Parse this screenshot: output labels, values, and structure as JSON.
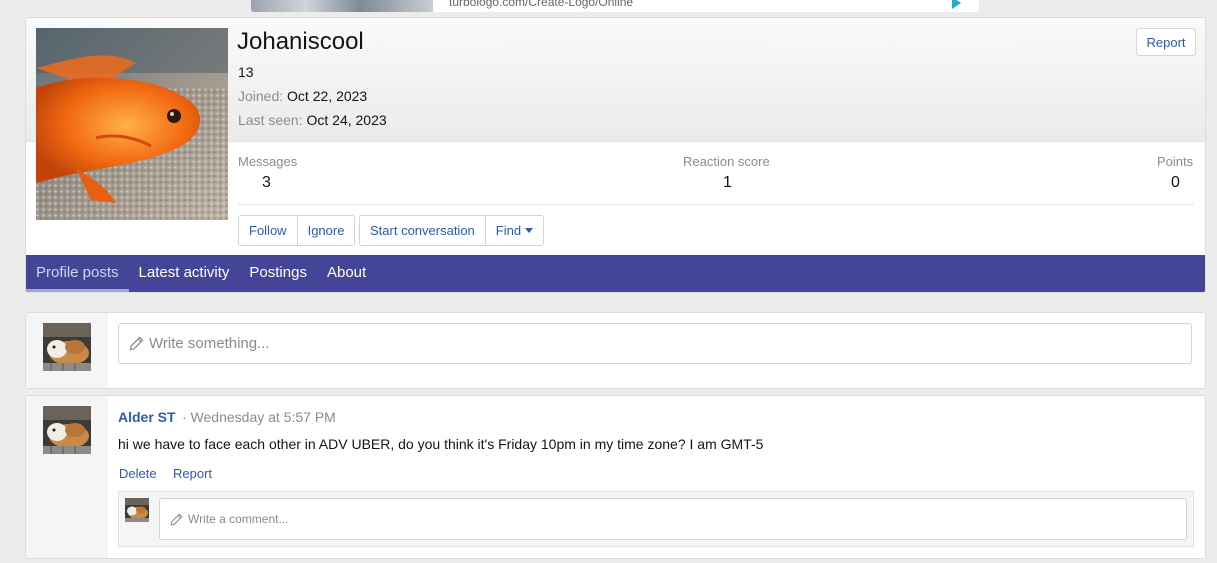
{
  "ad": {
    "text": "turbologo.com/Create-Logo/Online"
  },
  "profile": {
    "username": "Johaniscool",
    "user_title": "13",
    "joined_label": "Joined:",
    "joined_value": "Oct 22, 2023",
    "last_seen_label": "Last seen:",
    "last_seen_value": "Oct 24, 2023",
    "report_label": "Report",
    "stats": {
      "messages_label": "Messages",
      "messages_value": "3",
      "reaction_label": "Reaction score",
      "reaction_value": "1",
      "points_label": "Points",
      "points_value": "0"
    },
    "buttons": {
      "follow": "Follow",
      "ignore": "Ignore",
      "start_conversation": "Start conversation",
      "find": "Find"
    }
  },
  "tabs": [
    {
      "label": "Profile posts",
      "active": true
    },
    {
      "label": "Latest activity"
    },
    {
      "label": "Postings"
    },
    {
      "label": "About"
    }
  ],
  "write": {
    "placeholder": "Write something..."
  },
  "post": {
    "author": "Alder ST",
    "time": "· Wednesday at 5:57 PM",
    "body": "hi we have to face each other in ADV UBER, do you think it's Friday 10pm in my time zone? I am GMT-5",
    "delete_label": "Delete",
    "report_label": "Report",
    "comment_placeholder": "Write a comment..."
  },
  "colors": {
    "accent": "#454597",
    "link": "#2a5bb0",
    "page_bg": "#ececec"
  }
}
